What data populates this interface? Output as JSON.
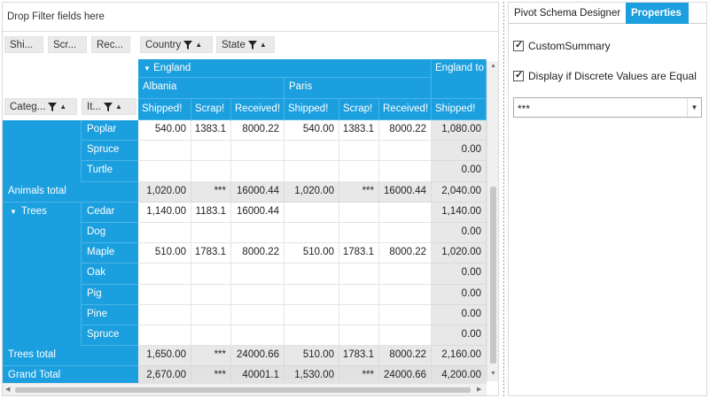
{
  "pivot": {
    "drop_filter_label": "Drop Filter fields here",
    "data_chips": [
      "Shi...",
      "Scr...",
      "Rec..."
    ],
    "column_chips": [
      "Country",
      "State"
    ],
    "row_chips": [
      "Categ...",
      "It..."
    ],
    "column_headers": {
      "england": "England",
      "england_total": "England to",
      "albania": "Albania",
      "paris": "Paris",
      "measures": [
        "Shipped!",
        "Scrap!",
        "Received!",
        "Shipped!",
        "Scrap!",
        "Received!",
        "Shipped!"
      ]
    },
    "rows": [
      {
        "category": "",
        "item": "Poplar",
        "values": [
          "540.00",
          "1383.1",
          "8000.22",
          "540.00",
          "1383.1",
          "8000.22",
          "1,080.00"
        ],
        "type": "data"
      },
      {
        "category": "",
        "item": "Spruce",
        "values": [
          "",
          "",
          "",
          "",
          "",
          "",
          "0.00"
        ],
        "type": "data"
      },
      {
        "category": "",
        "item": "Turtle",
        "values": [
          "",
          "",
          "",
          "",
          "",
          "",
          "0.00"
        ],
        "type": "data"
      },
      {
        "category": "Animals total",
        "item": "",
        "values": [
          "1,020.00",
          "***",
          "16000.44",
          "1,020.00",
          "***",
          "16000.44",
          "2,040.00"
        ],
        "type": "total"
      },
      {
        "category": "Trees",
        "item": "Cedar",
        "values": [
          "1,140.00",
          "1183.1",
          "16000.44",
          "",
          "",
          "",
          "1,140.00"
        ],
        "type": "data"
      },
      {
        "category": "",
        "item": "Dog",
        "values": [
          "",
          "",
          "",
          "",
          "",
          "",
          "0.00"
        ],
        "type": "data"
      },
      {
        "category": "",
        "item": "Maple",
        "values": [
          "510.00",
          "1783.1",
          "8000.22",
          "510.00",
          "1783.1",
          "8000.22",
          "1,020.00"
        ],
        "type": "data"
      },
      {
        "category": "",
        "item": "Oak",
        "values": [
          "",
          "",
          "",
          "",
          "",
          "",
          "0.00"
        ],
        "type": "data"
      },
      {
        "category": "",
        "item": "Pig",
        "values": [
          "",
          "",
          "",
          "",
          "",
          "",
          "0.00"
        ],
        "type": "data"
      },
      {
        "category": "",
        "item": "Pine",
        "values": [
          "",
          "",
          "",
          "",
          "",
          "",
          "0.00"
        ],
        "type": "data"
      },
      {
        "category": "",
        "item": "Spruce",
        "values": [
          "",
          "",
          "",
          "",
          "",
          "",
          "0.00"
        ],
        "type": "data"
      },
      {
        "category": "Trees total",
        "item": "",
        "values": [
          "1,650.00",
          "***",
          "24000.66",
          "510.00",
          "1783.1",
          "8000.22",
          "2,160.00"
        ],
        "type": "total"
      },
      {
        "category": "Grand Total",
        "item": "",
        "values": [
          "2,670.00",
          "***",
          "40001.1",
          "1,530.00",
          "***",
          "24000.66",
          "4,200.00"
        ],
        "type": "total"
      }
    ]
  },
  "panel": {
    "tabs": [
      "Pivot Schema Designer",
      "Properties"
    ],
    "checkboxes": [
      {
        "label": "CustomSummary",
        "checked": true
      },
      {
        "label": "Display if Discrete Values are Equal",
        "checked": true
      }
    ],
    "combo_value": "***"
  },
  "colors": {
    "accent": "#1b9fde",
    "total_bg": "#e8e8e8"
  }
}
